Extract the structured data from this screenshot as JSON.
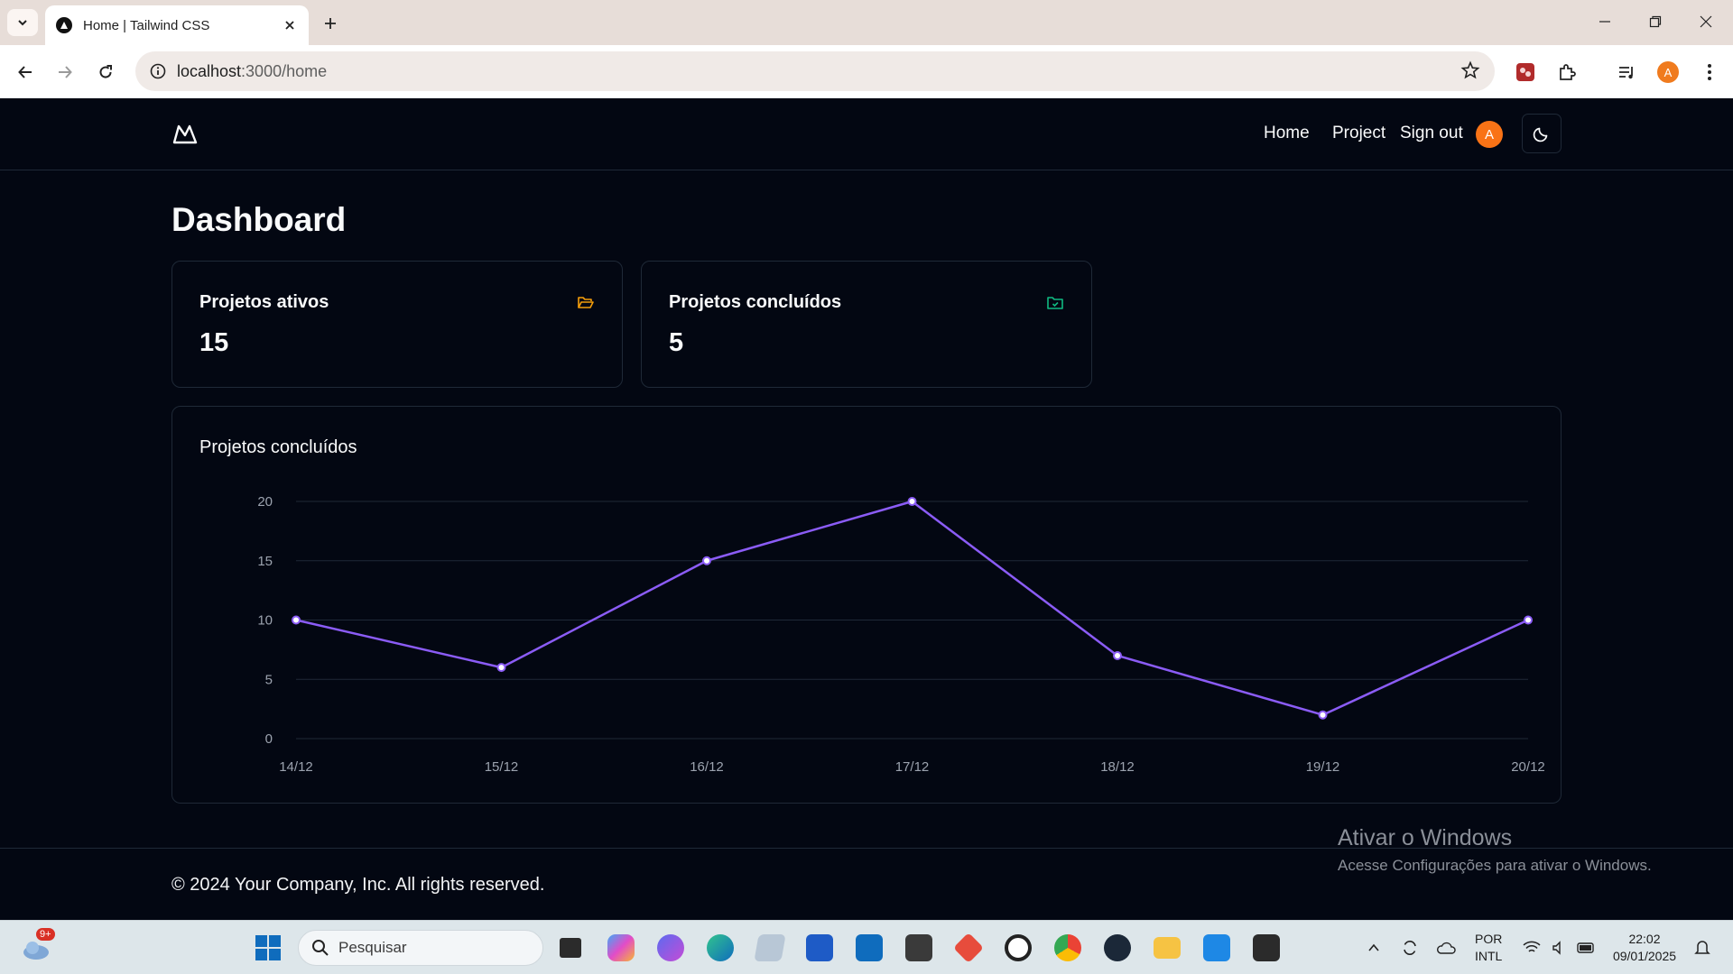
{
  "browser": {
    "tab_title": "Home | Tailwind CSS",
    "url_host": "localhost",
    "url_path": ":3000/home"
  },
  "header": {
    "nav": [
      "Home",
      "Project",
      "Sign out"
    ],
    "avatar_initial": "A"
  },
  "page": {
    "title": "Dashboard"
  },
  "stats": [
    {
      "label": "Projetos ativos",
      "value": "15",
      "icon": "folder-open-icon",
      "icon_color": "#f59e0b"
    },
    {
      "label": "Projetos concluídos",
      "value": "5",
      "icon": "folder-check-icon",
      "icon_color": "#10b981"
    }
  ],
  "chart_data": {
    "type": "line",
    "title": "Projetos concluídos",
    "x": [
      "14/12",
      "15/12",
      "16/12",
      "17/12",
      "18/12",
      "19/12",
      "20/12"
    ],
    "values": [
      10,
      6,
      15,
      20,
      7,
      2,
      10
    ],
    "yticks": [
      "0",
      "5",
      "10",
      "15",
      "20"
    ],
    "ylim": [
      0,
      20
    ],
    "grid": true,
    "line_color": "#8b5cf6"
  },
  "footer": {
    "text": "© 2024 Your Company, Inc. All rights reserved."
  },
  "watermark": {
    "title": "Ativar o Windows",
    "subtitle": "Acesse Configurações para ativar o Windows."
  },
  "taskbar": {
    "notification_badge": "9+",
    "search_placeholder": "Pesquisar",
    "language": "POR",
    "layout": "INTL",
    "time": "22:02",
    "date": "09/01/2025"
  }
}
